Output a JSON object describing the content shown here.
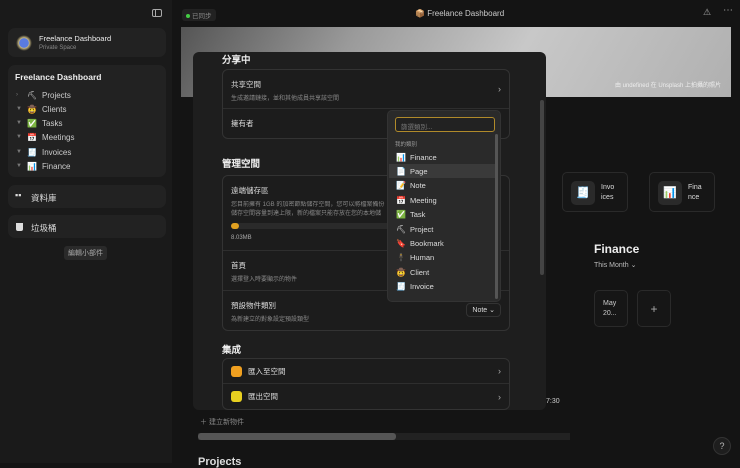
{
  "sidebar": {
    "workspace": {
      "name": "Freelance Dashboard",
      "subtitle": "Private Space"
    },
    "tree_title": "Freelance Dashboard",
    "items": [
      {
        "label": "Projects",
        "icon": "⛏"
      },
      {
        "label": "Clients",
        "icon": "🤠"
      },
      {
        "label": "Tasks",
        "icon": "✅"
      },
      {
        "label": "Meetings",
        "icon": "📅"
      },
      {
        "label": "Invoices",
        "icon": "🧾"
      },
      {
        "label": "Finance",
        "icon": "📊"
      }
    ],
    "library": "資料庫",
    "trash": "垃圾桶",
    "edit_widgets": "編輯小部件"
  },
  "header": {
    "sync_status": "已同步",
    "title": "Freelance Dashboard",
    "title_icon": "📦"
  },
  "banner": {
    "credit": "由 undefined 在 Unsplash 上拍攝的照片"
  },
  "modal": {
    "sharing": {
      "title": "分享中",
      "shared_space": {
        "label": "共享空間",
        "desc": "生成邀請鏈接，並和其他成員共享該空間"
      },
      "owner": {
        "label": "擁有者"
      }
    },
    "manage": {
      "title": "管理空間",
      "storage": {
        "label": "遠端儲存區",
        "desc1": "您目前擁有 1GB 的加密節點儲存空間，您可以將檔案備份",
        "desc2": "儲存空間容量到達上限，新的檔案只能存放在您的本地儲",
        "used": "8.03MB",
        "fraction": 0.01
      },
      "home": {
        "label": "首頁",
        "desc": "選擇登入時要顯示的物件"
      },
      "default_type": {
        "label": "預設物件類別",
        "desc": "為新建立的對象設定預設類型",
        "value": "Note"
      }
    },
    "integrations": {
      "title": "集成",
      "import": "匯入至空間",
      "export": "匯出空間"
    }
  },
  "dropdown": {
    "placeholder": "篩選類別...",
    "group": "我的類別",
    "items": [
      {
        "label": "Finance",
        "icon": "📊"
      },
      {
        "label": "Page",
        "icon": "📄"
      },
      {
        "label": "Note",
        "icon": "📝"
      },
      {
        "label": "Meeting",
        "icon": "📅"
      },
      {
        "label": "Task",
        "icon": "✅"
      },
      {
        "label": "Project",
        "icon": "⛏"
      },
      {
        "label": "Bookmark",
        "icon": "🔖"
      },
      {
        "label": "Human",
        "icon": "🕴"
      },
      {
        "label": "Client",
        "icon": "🤠"
      },
      {
        "label": "Invoice",
        "icon": "🧾"
      }
    ]
  },
  "dashboard": {
    "widgets": [
      {
        "label1": "Invo",
        "label2": "ices",
        "icon": "🧾"
      },
      {
        "label1": "Fina",
        "label2": "nce",
        "icon": "📊"
      }
    ],
    "finance": {
      "title": "Finance",
      "period": "This Month",
      "card1": "May",
      "card2": "20...",
      "add": "+"
    },
    "time": "7:30",
    "new_object": "建立新物件",
    "section": "Projects"
  },
  "help": "?"
}
